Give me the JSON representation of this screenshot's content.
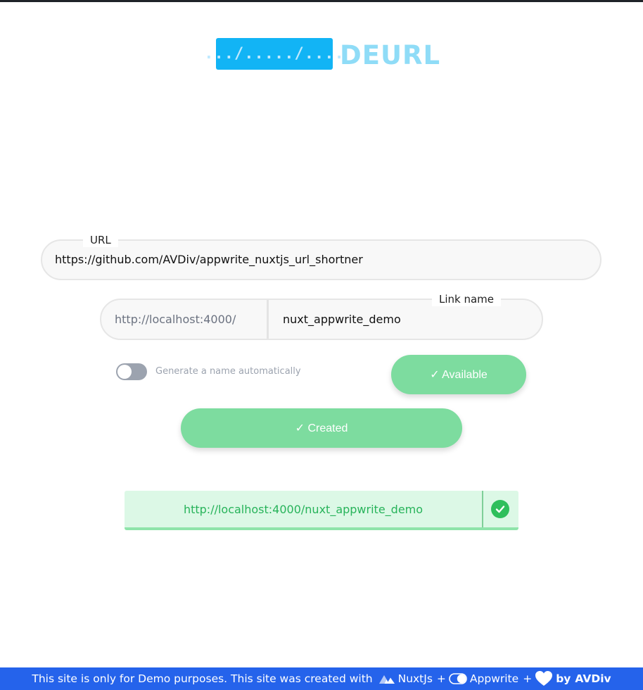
{
  "logo": {
    "box_text": ".../...../....",
    "name": "DEURL",
    "box_color": "#12b4f5",
    "name_color": "#8fdcf7"
  },
  "form": {
    "url": {
      "label": "URL",
      "value": "https://github.com/AVDiv/appwrite_nuxtjs_url_shortner"
    },
    "link": {
      "prefix": "http://localhost:4000/",
      "label": "Link name",
      "value": "nuxt_appwrite_demo"
    },
    "toggle": {
      "label": "Generate a name automatically",
      "checked": false
    },
    "available_button": "✓ Available",
    "created_button": "✓ Created"
  },
  "result": {
    "url": "http://localhost:4000/nuxt_appwrite_demo",
    "status_icon": "check-circle-icon",
    "accent": "#2fbf5c"
  },
  "footer": {
    "text": "This site is only for Demo purposes. This site was created with",
    "nuxt": "NuxtJs",
    "plus1": "+",
    "appwrite": "Appwrite",
    "plus2": "+",
    "by": "by",
    "author": "AVDiv",
    "background": "#2563eb"
  }
}
